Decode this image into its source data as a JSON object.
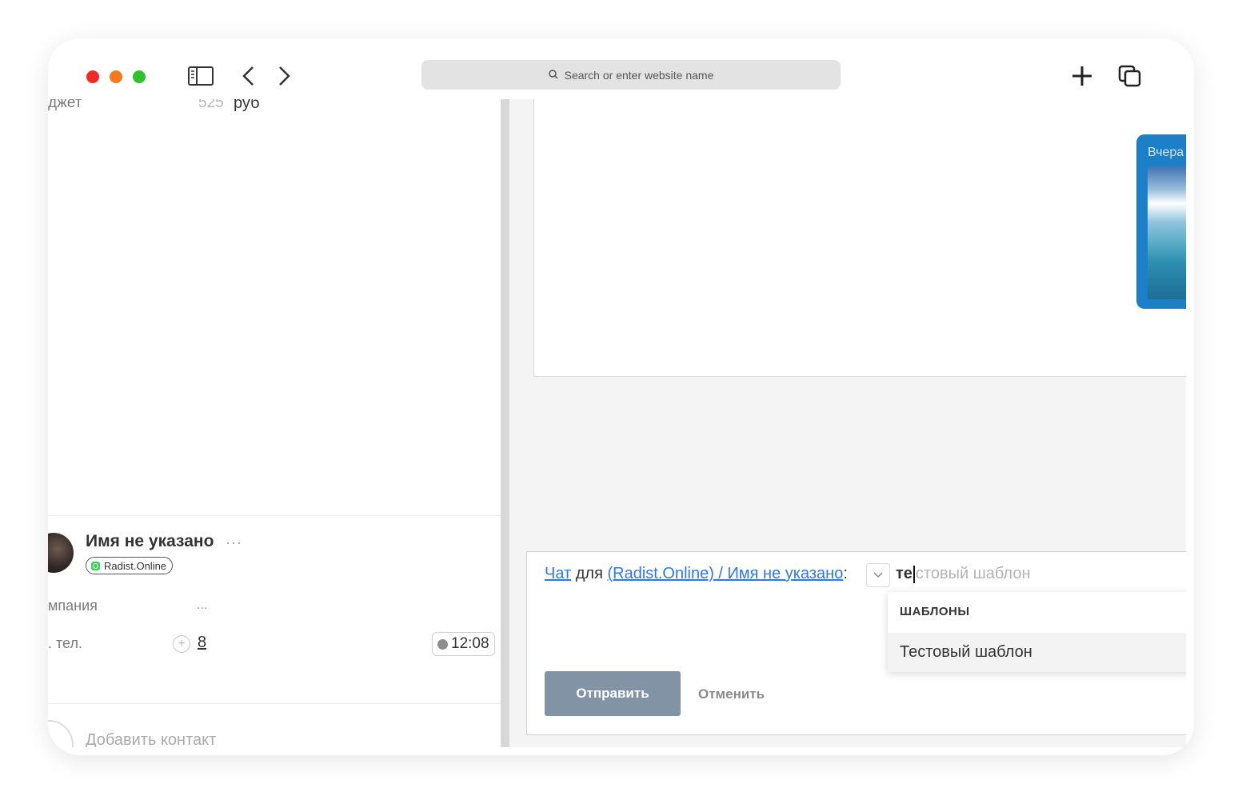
{
  "browser": {
    "address_placeholder": "Search or enter website name"
  },
  "left_panel": {
    "budget": {
      "label": "джет",
      "amount": "525",
      "currency": "руб"
    },
    "contact": {
      "name": "Имя не указано",
      "more": "···",
      "source": "Radist.Online",
      "fields": [
        {
          "label": "мпания",
          "value": "..."
        },
        {
          "label": ". тел.",
          "value": "8"
        }
      ],
      "time": "12:08"
    },
    "add_contact": "Добавить контакт"
  },
  "chat": {
    "message_time": "Вчера"
  },
  "composer": {
    "chat_link": "Чат",
    "for_text": "для",
    "recipient_link": "(Radist.Online) / Имя не указано",
    "colon": ":",
    "typed_text": "те",
    "suggestion_rest": "стовый шаблон",
    "dropdown": {
      "header": "ШАБЛОНЫ",
      "items": [
        "Тестовый шаблон"
      ]
    },
    "send_label": "Отправить",
    "cancel_label": "Отменить"
  },
  "colors": {
    "link": "#2f78e6",
    "send_button": "#8393a6",
    "message_card": "#1c7fc7"
  }
}
